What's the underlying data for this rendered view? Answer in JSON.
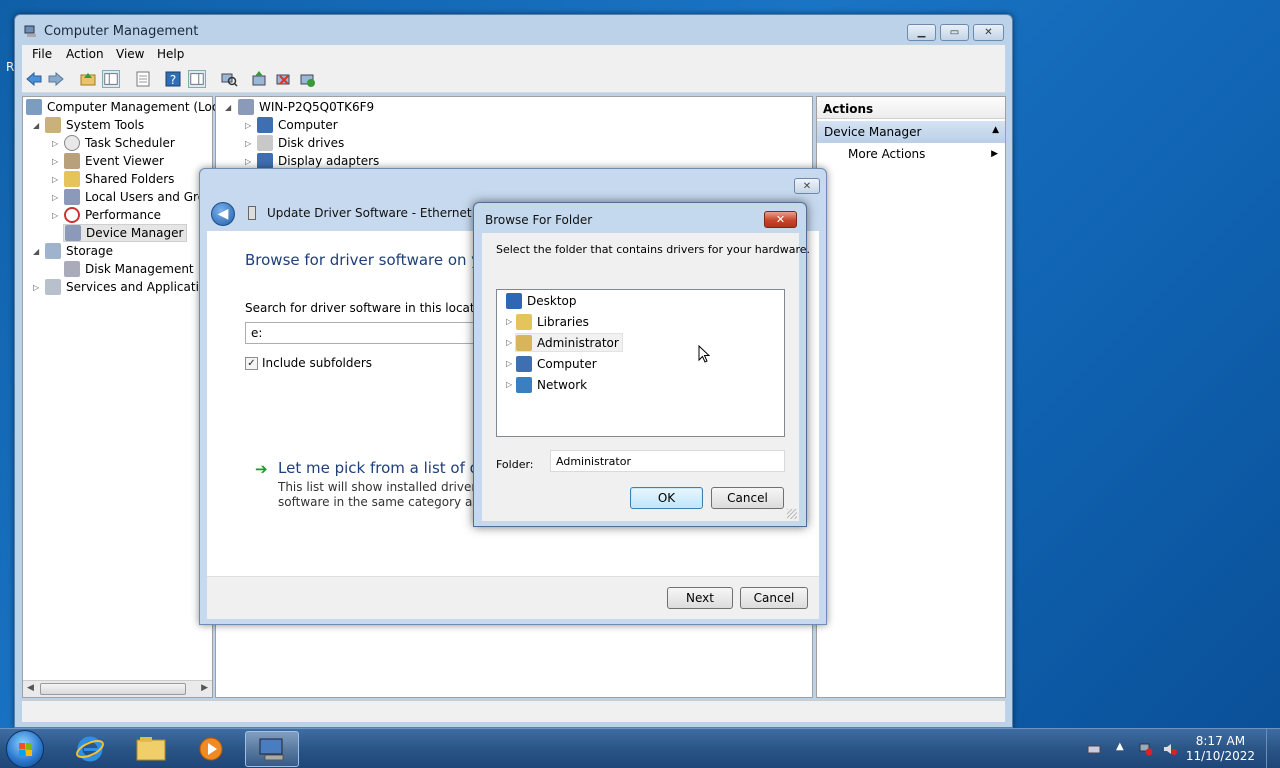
{
  "desktop": {
    "edge_letter": "R"
  },
  "cm": {
    "title": "Computer Management",
    "menu": [
      "File",
      "Action",
      "View",
      "Help"
    ],
    "left_tree": {
      "root": "Computer Management (Local",
      "system_tools": "System Tools",
      "task_scheduler": "Task Scheduler",
      "event_viewer": "Event Viewer",
      "shared_folders": "Shared Folders",
      "local_users": "Local Users and Group",
      "performance": "Performance",
      "device_manager": "Device Manager",
      "storage": "Storage",
      "disk_management": "Disk Management",
      "services": "Services and Applications"
    },
    "center_tree": {
      "host": "WIN-P2Q5Q0TK6F9",
      "computer": "Computer",
      "disk_drives": "Disk drives",
      "display_adapters": "Display adapters"
    },
    "actions": {
      "header": "Actions",
      "section": "Device Manager",
      "more": "More Actions"
    }
  },
  "update_driver": {
    "title": "Update Driver Software - Ethernet Cont",
    "heading": "Browse for driver software on yo",
    "search_label": "Search for driver software in this location:",
    "path_value": "e:",
    "include_subfolders": "Include subfolders",
    "include_subfolders_checked": true,
    "pick_link": "Let me pick from a list of dev",
    "pick_desc_1": "This list will show installed driver soft",
    "pick_desc_2": "software in the same category as the",
    "next": "Next",
    "cancel": "Cancel"
  },
  "browse": {
    "title": "Browse For Folder",
    "instruction": "Select the folder that contains drivers for your hardware.",
    "items": [
      "Desktop",
      "Libraries",
      "Administrator",
      "Computer",
      "Network"
    ],
    "folder_label": "Folder:",
    "folder_value": "Administrator",
    "ok": "OK",
    "cancel": "Cancel"
  },
  "taskbar": {
    "time": "8:17 AM",
    "date": "11/10/2022"
  },
  "colors": {
    "desktop": "#1a74c4",
    "link_blue": "#1e3f7a",
    "close_red": "#c8452c",
    "actions_section": "#c6d9ee"
  }
}
